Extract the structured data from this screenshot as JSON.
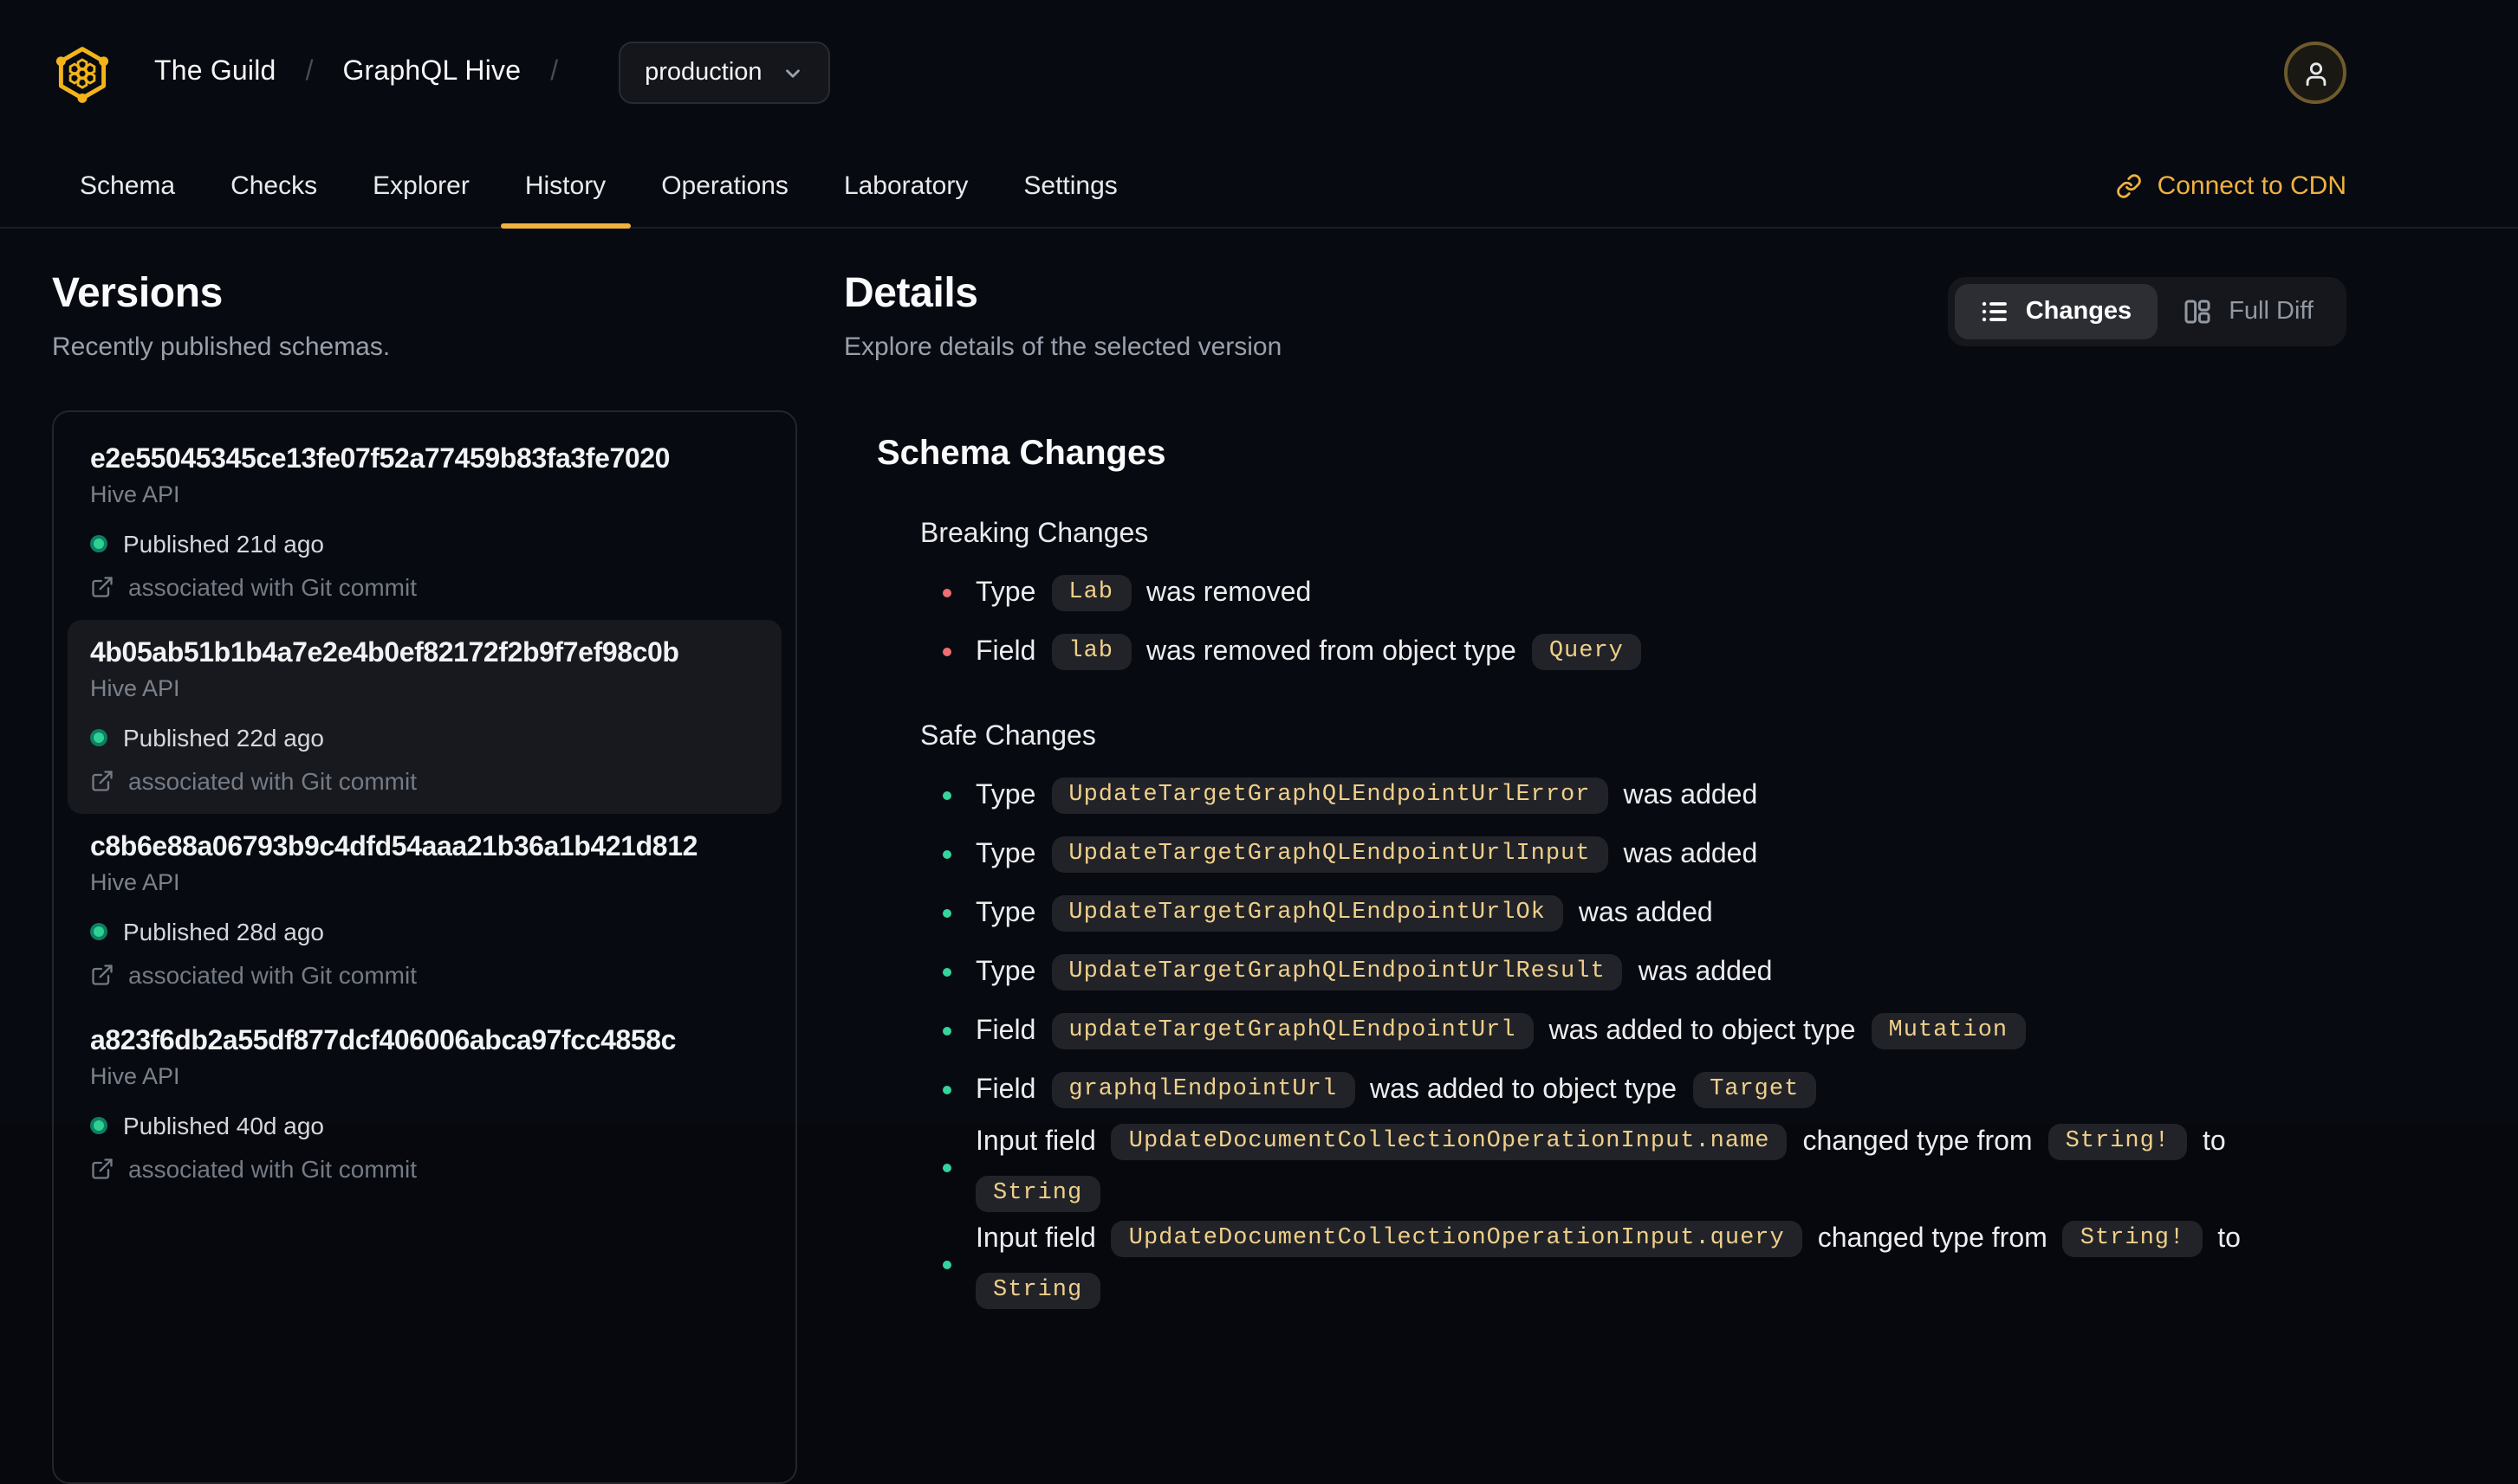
{
  "colors": {
    "accent": "#f0b13f",
    "logo_yellow": "#f3b41b",
    "breaking_bullet": "#ee6e72",
    "safe_bullet": "#35d49f",
    "published_dot": "#2fd193",
    "chip_text": "#efd08a",
    "chip_bg": "#222329",
    "page_bg": "#070a10"
  },
  "header": {
    "logo": "hive-honeycomb-logo",
    "org": "The Guild",
    "project": "GraphQL Hive",
    "breadcrumb_separator": "/",
    "target_dropdown": {
      "value": "production",
      "icon": "chevron-down-icon"
    },
    "avatar": "user-icon",
    "nav_tabs": [
      {
        "label": "Schema",
        "active": false
      },
      {
        "label": "Checks",
        "active": false
      },
      {
        "label": "Explorer",
        "active": false
      },
      {
        "label": "History",
        "active": true
      },
      {
        "label": "Operations",
        "active": false
      },
      {
        "label": "Laboratory",
        "active": false
      },
      {
        "label": "Settings",
        "active": false
      }
    ],
    "cdn_link": {
      "label": "Connect to CDN",
      "icon": "link-icon"
    }
  },
  "versions": {
    "title": "Versions",
    "subtitle": "Recently published schemas.",
    "items": [
      {
        "hash": "e2e55045345ce13fe07f52a77459b83fa3fe7020",
        "service": "Hive API",
        "status": "Published 21d ago",
        "git": "associated with Git commit",
        "selected": false
      },
      {
        "hash": "4b05ab51b1b4a7e2e4b0ef82172f2b9f7ef98c0b",
        "service": "Hive API",
        "status": "Published 22d ago",
        "git": "associated with Git commit",
        "selected": true
      },
      {
        "hash": "c8b6e88a06793b9c4dfd54aaa21b36a1b421d812",
        "service": "Hive API",
        "status": "Published 28d ago",
        "git": "associated with Git commit",
        "selected": false
      },
      {
        "hash": "a823f6db2a55df877dcf406006abca97fcc4858c",
        "service": "Hive API",
        "status": "Published 40d ago",
        "git": "associated with Git commit",
        "selected": false
      }
    ]
  },
  "details": {
    "title": "Details",
    "subtitle": "Explore details of the selected version",
    "view_toggle": {
      "options": [
        {
          "label": "Changes",
          "active": true,
          "icon": "list-icon"
        },
        {
          "label": "Full Diff",
          "active": false,
          "icon": "columns-icon"
        }
      ]
    },
    "schema_changes": {
      "title": "Schema Changes",
      "sections": [
        {
          "id": "breaking",
          "title": "Breaking Changes",
          "bullet_color": "#ee6e72",
          "items": [
            [
              {
                "t": "text",
                "v": "Type"
              },
              {
                "t": "code",
                "v": "Lab"
              },
              {
                "t": "text",
                "v": "was removed"
              }
            ],
            [
              {
                "t": "text",
                "v": "Field"
              },
              {
                "t": "code",
                "v": "lab"
              },
              {
                "t": "text",
                "v": "was removed from object type"
              },
              {
                "t": "code",
                "v": "Query"
              }
            ]
          ]
        },
        {
          "id": "safe",
          "title": "Safe Changes",
          "bullet_color": "#35d49f",
          "items": [
            [
              {
                "t": "text",
                "v": "Type"
              },
              {
                "t": "code",
                "v": "UpdateTargetGraphQLEndpointUrlError"
              },
              {
                "t": "text",
                "v": "was added"
              }
            ],
            [
              {
                "t": "text",
                "v": "Type"
              },
              {
                "t": "code",
                "v": "UpdateTargetGraphQLEndpointUrlInput"
              },
              {
                "t": "text",
                "v": "was added"
              }
            ],
            [
              {
                "t": "text",
                "v": "Type"
              },
              {
                "t": "code",
                "v": "UpdateTargetGraphQLEndpointUrlOk"
              },
              {
                "t": "text",
                "v": "was added"
              }
            ],
            [
              {
                "t": "text",
                "v": "Type"
              },
              {
                "t": "code",
                "v": "UpdateTargetGraphQLEndpointUrlResult"
              },
              {
                "t": "text",
                "v": "was added"
              }
            ],
            [
              {
                "t": "text",
                "v": "Field"
              },
              {
                "t": "code",
                "v": "updateTargetGraphQLEndpointUrl"
              },
              {
                "t": "text",
                "v": "was added to object type"
              },
              {
                "t": "code",
                "v": "Mutation"
              }
            ],
            [
              {
                "t": "text",
                "v": "Field"
              },
              {
                "t": "code",
                "v": "graphqlEndpointUrl"
              },
              {
                "t": "text",
                "v": "was added to object type"
              },
              {
                "t": "code",
                "v": "Target"
              }
            ],
            [
              {
                "t": "text",
                "v": "Input field"
              },
              {
                "t": "code",
                "v": "UpdateDocumentCollectionOperationInput.name"
              },
              {
                "t": "text",
                "v": "changed type from"
              },
              {
                "t": "code",
                "v": "String!"
              },
              {
                "t": "text",
                "v": "to"
              },
              {
                "t": "code",
                "v": "String"
              }
            ],
            [
              {
                "t": "text",
                "v": "Input field"
              },
              {
                "t": "code",
                "v": "UpdateDocumentCollectionOperationInput.query"
              },
              {
                "t": "text",
                "v": "changed type from"
              },
              {
                "t": "code",
                "v": "String!"
              },
              {
                "t": "text",
                "v": "to"
              },
              {
                "t": "code",
                "v": "String"
              }
            ]
          ]
        }
      ]
    }
  }
}
